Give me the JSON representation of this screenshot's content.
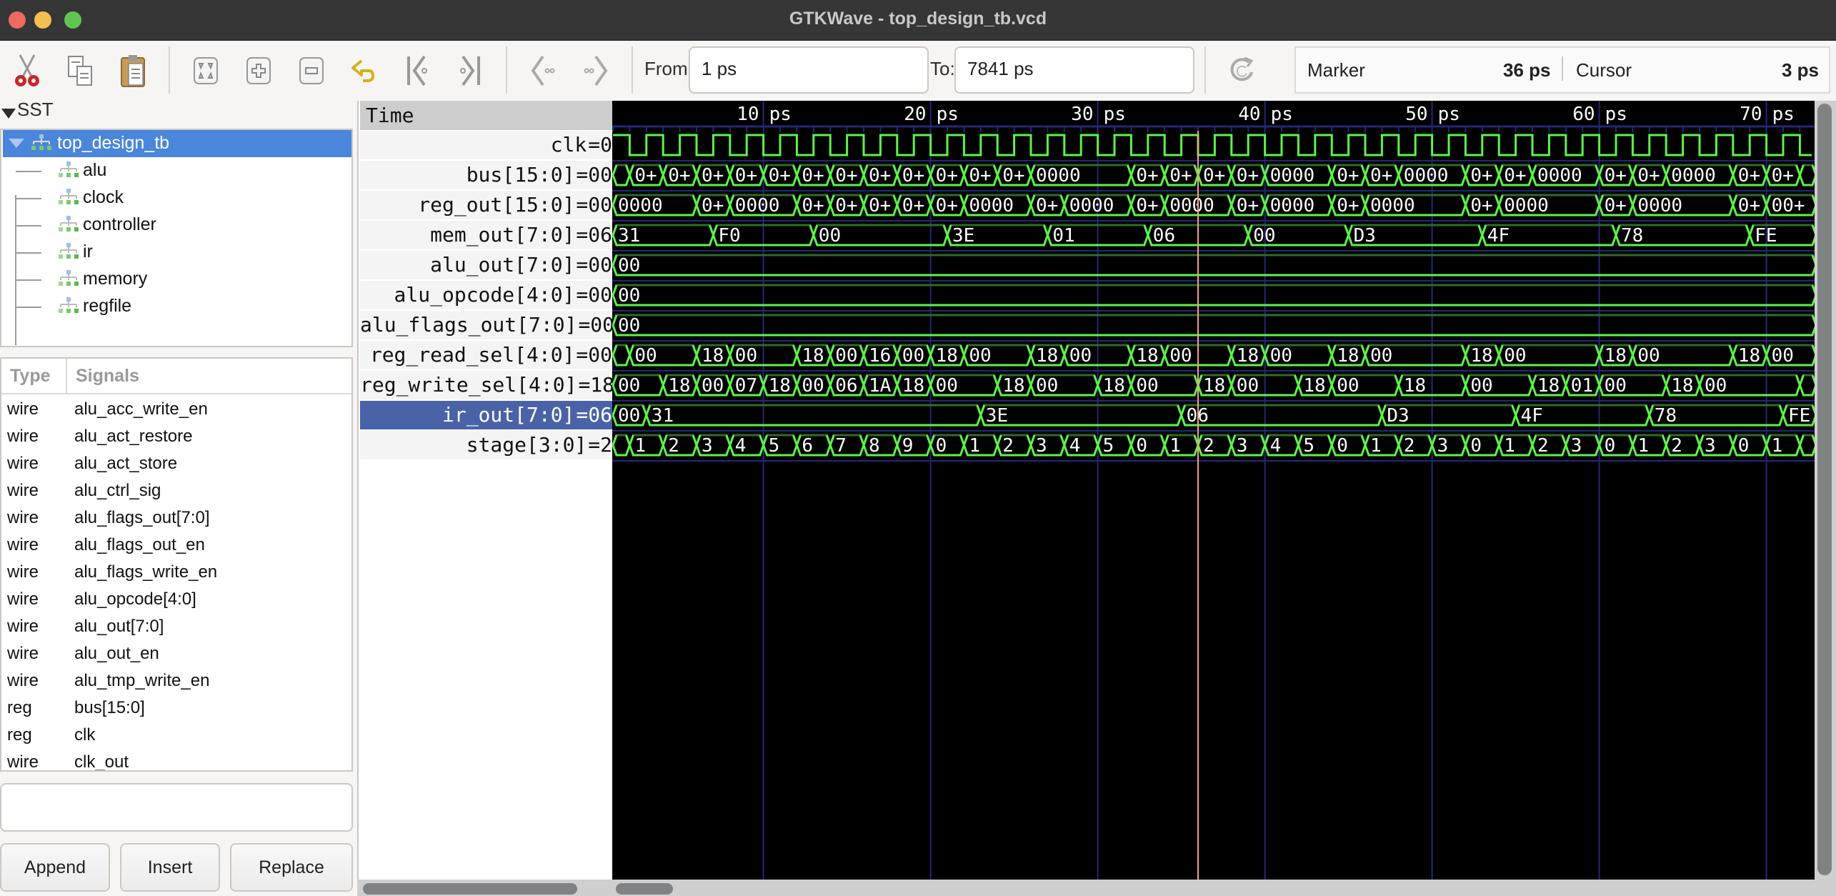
{
  "window": {
    "title": "GTKWave - top_design_tb.vcd"
  },
  "toolbar": {
    "icons": [
      "cut-icon",
      "copy-icon",
      "paste-icon",
      "zoom-fit-icon",
      "zoom-in-icon",
      "zoom-out-icon",
      "undo-zoom-icon",
      "zoom-to-start-icon",
      "zoom-to-end-icon",
      "find-previous-edge-icon",
      "find-next-edge-icon",
      "reload-icon"
    ],
    "from_label": "From:",
    "from_value": "1 ps",
    "to_label": "To:",
    "to_value": "7841 ps",
    "marker_label": "Marker",
    "marker_value": "36 ps",
    "cursor_label": "Cursor",
    "cursor_value": "3 ps"
  },
  "sst": {
    "header": "SST",
    "root": "top_design_tb",
    "children": [
      "alu",
      "clock",
      "controller",
      "ir",
      "memory",
      "regfile"
    ]
  },
  "signals": {
    "col_type": "Type",
    "col_signals": "Signals",
    "rows": [
      {
        "type": "wire",
        "name": "alu_acc_write_en"
      },
      {
        "type": "wire",
        "name": "alu_act_restore"
      },
      {
        "type": "wire",
        "name": "alu_act_store"
      },
      {
        "type": "wire",
        "name": "alu_ctrl_sig"
      },
      {
        "type": "wire",
        "name": "alu_flags_out[7:0]"
      },
      {
        "type": "wire",
        "name": "alu_flags_out_en"
      },
      {
        "type": "wire",
        "name": "alu_flags_write_en"
      },
      {
        "type": "wire",
        "name": "alu_opcode[4:0]"
      },
      {
        "type": "wire",
        "name": "alu_out[7:0]"
      },
      {
        "type": "wire",
        "name": "alu_out_en"
      },
      {
        "type": "wire",
        "name": "alu_tmp_write_en"
      },
      {
        "type": "reg",
        "name": "bus[15:0]"
      },
      {
        "type": "reg",
        "name": "clk"
      },
      {
        "type": "wire",
        "name": "clk_out"
      }
    ],
    "search_value": "",
    "buttons": {
      "append": "Append",
      "insert": "Insert",
      "replace": "Replace"
    }
  },
  "waves": {
    "time_header": "Time",
    "time_unit": "ps",
    "view_start_ps": 1,
    "view_end_ps": 73,
    "major_ticks": [
      10,
      20,
      30,
      40,
      50,
      60,
      70
    ],
    "marker_ps": 36,
    "colors": {
      "wave": "#5ef34a",
      "wave_dim": "#2e6b26",
      "grid": "#26267a",
      "marker": "#f2a08c",
      "background": "#000000"
    },
    "traces": [
      {
        "label": "clk",
        "value": "=0",
        "kind": "clock",
        "period_ps": 2,
        "start_high": true
      },
      {
        "label": "bus[15:0]",
        "value": "=00",
        "kind": "bus",
        "changes": [
          [
            1,
            "+"
          ],
          [
            2,
            "0+"
          ],
          [
            4,
            "0+"
          ],
          [
            6,
            "0+"
          ],
          [
            8,
            "0+"
          ],
          [
            10,
            "0+"
          ],
          [
            12,
            "0+"
          ],
          [
            14,
            "0+"
          ],
          [
            16,
            "0+"
          ],
          [
            18,
            "0+"
          ],
          [
            20,
            "0+"
          ],
          [
            22,
            "0+"
          ],
          [
            24,
            "0+"
          ],
          [
            26,
            "0000"
          ],
          [
            32,
            "0+"
          ],
          [
            34,
            "0+"
          ],
          [
            36,
            "0+"
          ],
          [
            38,
            "0+"
          ],
          [
            40,
            "0000"
          ],
          [
            44,
            "0+"
          ],
          [
            46,
            "0+"
          ],
          [
            48,
            "0000"
          ],
          [
            52,
            "0+"
          ],
          [
            54,
            "0+"
          ],
          [
            56,
            "0000"
          ],
          [
            60,
            "0+"
          ],
          [
            62,
            "0+"
          ],
          [
            64,
            "0000"
          ],
          [
            68,
            "0+"
          ],
          [
            70,
            "0+"
          ],
          [
            72,
            "0+"
          ]
        ]
      },
      {
        "label": "reg_out[15:0]",
        "value": "=00",
        "kind": "bus",
        "changes": [
          [
            1,
            "0000"
          ],
          [
            6,
            "0+"
          ],
          [
            8,
            "0000"
          ],
          [
            12,
            "0+"
          ],
          [
            14,
            "0+"
          ],
          [
            16,
            "0+"
          ],
          [
            18,
            "0+"
          ],
          [
            20,
            "0+"
          ],
          [
            22,
            "0000"
          ],
          [
            26,
            "0+"
          ],
          [
            28,
            "0000"
          ],
          [
            32,
            "0+"
          ],
          [
            34,
            "0000"
          ],
          [
            38,
            "0+"
          ],
          [
            40,
            "0000"
          ],
          [
            44,
            "0+"
          ],
          [
            46,
            "0000"
          ],
          [
            52,
            "0+"
          ],
          [
            54,
            "0000"
          ],
          [
            60,
            "0+"
          ],
          [
            62,
            "0000"
          ],
          [
            68,
            "0+"
          ],
          [
            70,
            "0000"
          ]
        ]
      },
      {
        "label": "mem_out[7:0]",
        "value": "=06",
        "kind": "bus",
        "changes": [
          [
            1,
            "31"
          ],
          [
            7,
            "F0"
          ],
          [
            13,
            "00"
          ],
          [
            21,
            "3E"
          ],
          [
            27,
            "01"
          ],
          [
            33,
            "06"
          ],
          [
            39,
            "00"
          ],
          [
            45,
            "D3"
          ],
          [
            53,
            "4F"
          ],
          [
            61,
            "78"
          ],
          [
            69,
            "FE"
          ]
        ]
      },
      {
        "label": "alu_out[7:0]",
        "value": "=00",
        "kind": "bus",
        "changes": [
          [
            1,
            "00"
          ]
        ]
      },
      {
        "label": "alu_opcode[4:0]",
        "value": "=00",
        "kind": "bus",
        "changes": [
          [
            1,
            "00"
          ]
        ]
      },
      {
        "label": "alu_flags_out[7:0]",
        "value": "=00",
        "kind": "bus",
        "changes": [
          [
            1,
            "00"
          ]
        ]
      },
      {
        "label": "reg_read_sel[4:0]",
        "value": "=00",
        "kind": "bus",
        "changes": [
          [
            1,
            "+"
          ],
          [
            2,
            "00"
          ],
          [
            6,
            "18"
          ],
          [
            8,
            "00"
          ],
          [
            12,
            "18"
          ],
          [
            14,
            "00"
          ],
          [
            16,
            "16"
          ],
          [
            18,
            "00"
          ],
          [
            20,
            "18"
          ],
          [
            22,
            "00"
          ],
          [
            26,
            "18"
          ],
          [
            28,
            "00"
          ],
          [
            32,
            "18"
          ],
          [
            34,
            "00"
          ],
          [
            38,
            "18"
          ],
          [
            40,
            "00"
          ],
          [
            44,
            "18"
          ],
          [
            46,
            "00"
          ],
          [
            52,
            "18"
          ],
          [
            54,
            "00"
          ],
          [
            60,
            "18"
          ],
          [
            62,
            "00"
          ],
          [
            68,
            "18"
          ],
          [
            70,
            "00"
          ]
        ]
      },
      {
        "label": "reg_write_sel[4:0]",
        "value": "=18",
        "kind": "bus",
        "changes": [
          [
            1,
            "00"
          ],
          [
            4,
            "18"
          ],
          [
            6,
            "00"
          ],
          [
            8,
            "07"
          ],
          [
            10,
            "18"
          ],
          [
            12,
            "00"
          ],
          [
            14,
            "06"
          ],
          [
            16,
            "1A"
          ],
          [
            18,
            "18"
          ],
          [
            20,
            "00"
          ],
          [
            24,
            "18"
          ],
          [
            26,
            "00"
          ],
          [
            30,
            "18"
          ],
          [
            32,
            "00"
          ],
          [
            36,
            "18"
          ],
          [
            38,
            "00"
          ],
          [
            42,
            "18"
          ],
          [
            44,
            "00"
          ],
          [
            48,
            "18"
          ],
          [
            52,
            "00"
          ],
          [
            56,
            "18"
          ],
          [
            58,
            "01"
          ],
          [
            60,
            "00"
          ],
          [
            64,
            "18"
          ],
          [
            66,
            "00"
          ],
          [
            72,
            "18"
          ]
        ]
      },
      {
        "label": "ir_out[7:0]",
        "value": "=06",
        "kind": "bus",
        "selected": true,
        "changes": [
          [
            1,
            "00"
          ],
          [
            3,
            "31"
          ],
          [
            23,
            "3E"
          ],
          [
            35,
            "06"
          ],
          [
            47,
            "D3"
          ],
          [
            55,
            "4F"
          ],
          [
            63,
            "78"
          ],
          [
            71,
            "FE"
          ]
        ]
      },
      {
        "label": "stage[3:0]",
        "value": "=2",
        "kind": "bus",
        "changes": [
          [
            1,
            "0"
          ],
          [
            2,
            "1"
          ],
          [
            4,
            "2"
          ],
          [
            6,
            "3"
          ],
          [
            8,
            "4"
          ],
          [
            10,
            "5"
          ],
          [
            12,
            "6"
          ],
          [
            14,
            "7"
          ],
          [
            16,
            "8"
          ],
          [
            18,
            "9"
          ],
          [
            20,
            "0"
          ],
          [
            22,
            "1"
          ],
          [
            24,
            "2"
          ],
          [
            26,
            "3"
          ],
          [
            28,
            "4"
          ],
          [
            30,
            "5"
          ],
          [
            32,
            "0"
          ],
          [
            34,
            "1"
          ],
          [
            36,
            "2"
          ],
          [
            38,
            "3"
          ],
          [
            40,
            "4"
          ],
          [
            42,
            "5"
          ],
          [
            44,
            "0"
          ],
          [
            46,
            "1"
          ],
          [
            48,
            "2"
          ],
          [
            50,
            "3"
          ],
          [
            52,
            "0"
          ],
          [
            54,
            "1"
          ],
          [
            56,
            "2"
          ],
          [
            58,
            "3"
          ],
          [
            60,
            "0"
          ],
          [
            62,
            "1"
          ],
          [
            64,
            "2"
          ],
          [
            66,
            "3"
          ],
          [
            68,
            "0"
          ],
          [
            70,
            "1"
          ],
          [
            72,
            "2"
          ]
        ]
      }
    ]
  }
}
